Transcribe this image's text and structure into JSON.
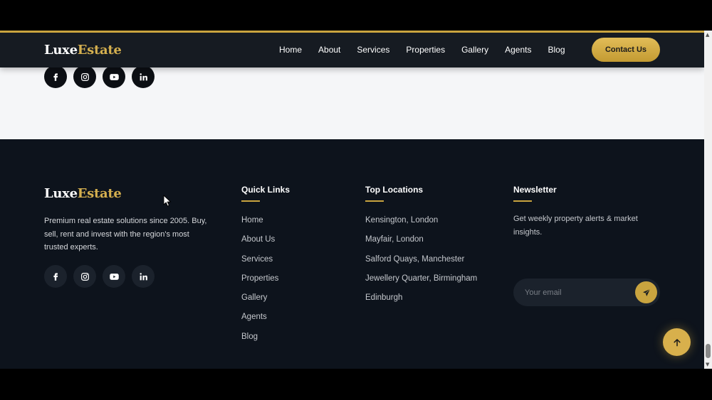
{
  "brand": {
    "part1": "Luxe",
    "part2": "Estate"
  },
  "nav": {
    "links": [
      "Home",
      "About",
      "Services",
      "Properties",
      "Gallery",
      "Agents",
      "Blog"
    ],
    "cta": "Contact Us"
  },
  "social_icons": [
    "facebook-icon",
    "instagram-icon",
    "youtube-icon",
    "linkedin-icon"
  ],
  "footer": {
    "description": "Premium real estate solutions since 2005. Buy, sell, rent and invest with the region's most trusted experts.",
    "quick_links": {
      "title": "Quick Links",
      "items": [
        "Home",
        "About Us",
        "Services",
        "Properties",
        "Gallery",
        "Agents",
        "Blog"
      ]
    },
    "top_locations": {
      "title": "Top Locations",
      "items": [
        "Kensington, London",
        "Mayfair, London",
        "Salford Quays, Manchester",
        "Jewellery Quarter, Birmingham",
        "Edinburgh"
      ]
    },
    "newsletter": {
      "title": "Newsletter",
      "description": "Get weekly property alerts & market insights.",
      "placeholder": "Your email"
    }
  },
  "colors": {
    "gold": "#c9a43f",
    "navbar": "#161b22",
    "footer": "#0d131c",
    "light_section": "#f5f6f8"
  }
}
